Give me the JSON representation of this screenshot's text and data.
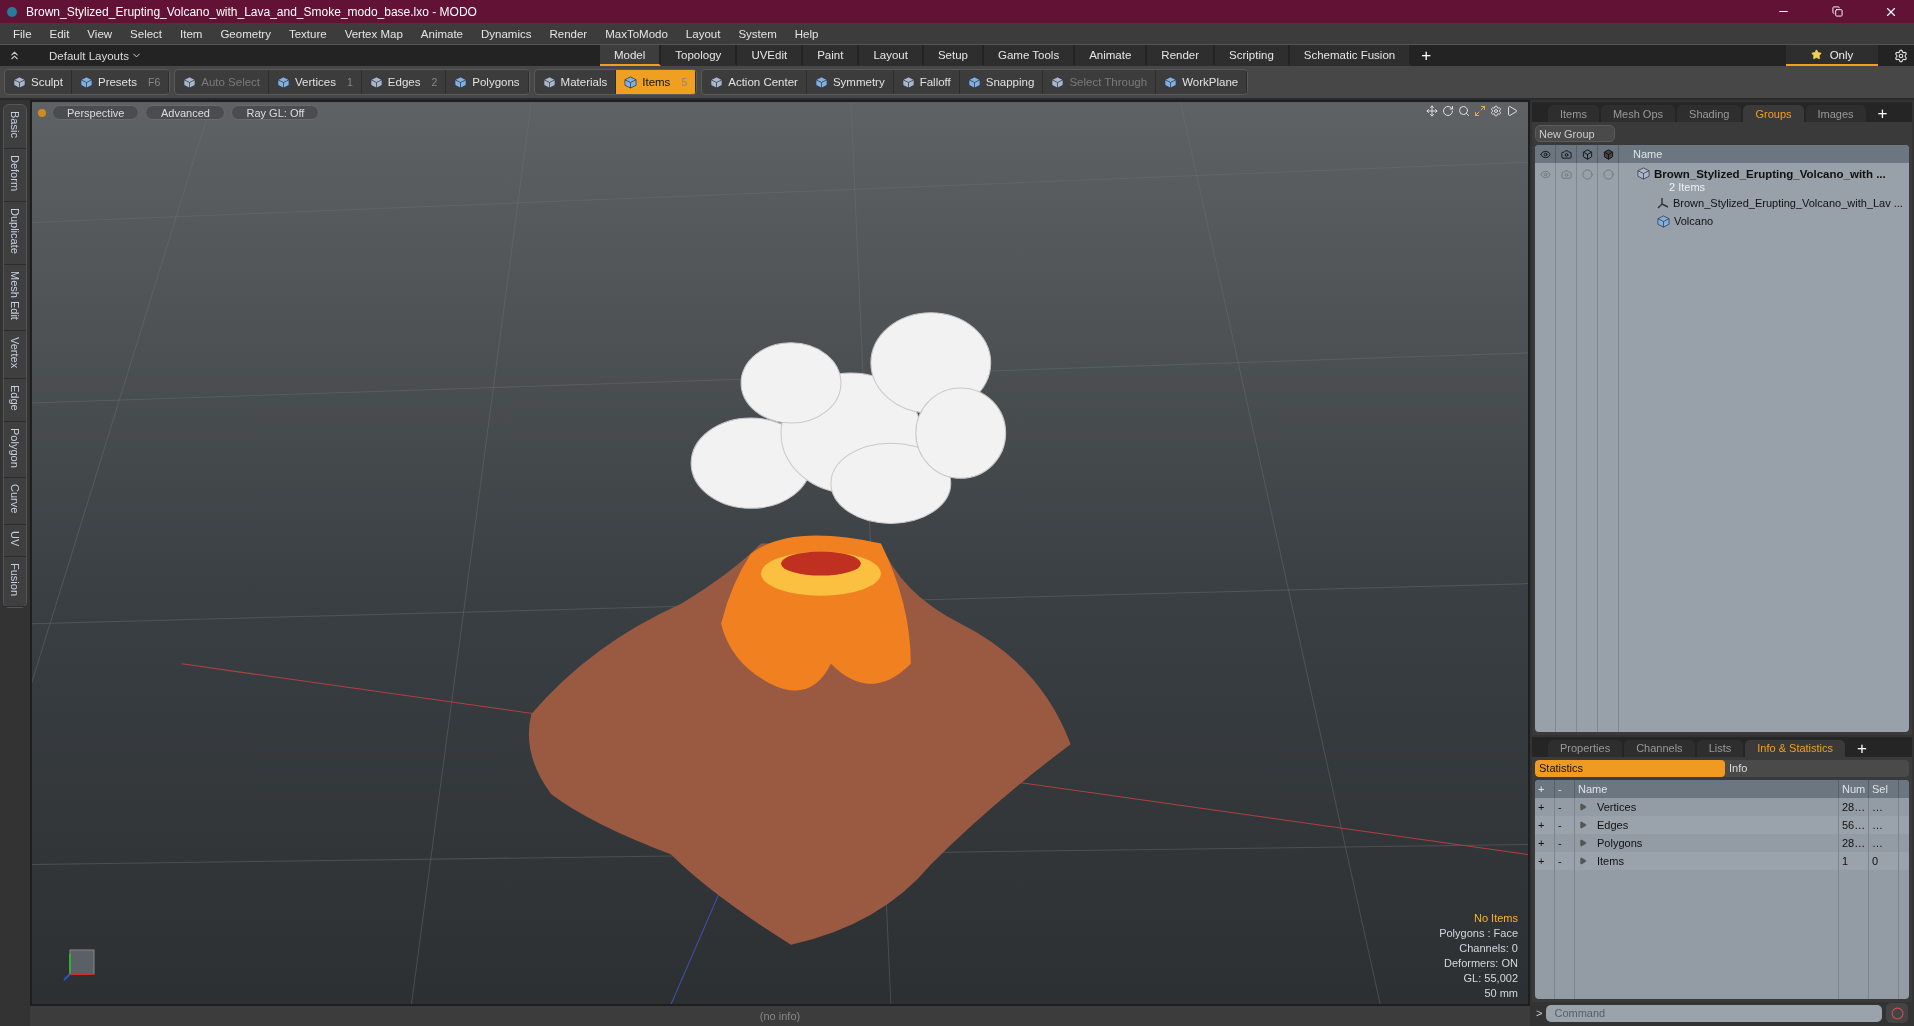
{
  "window": {
    "title": "Brown_Stylized_Erupting_Volcano_with_Lava_and_Smoke_modo_base.lxo - MODO"
  },
  "menu": [
    "File",
    "Edit",
    "View",
    "Select",
    "Item",
    "Geometry",
    "Texture",
    "Vertex Map",
    "Animate",
    "Dynamics",
    "Render",
    "MaxToModo",
    "Layout",
    "System",
    "Help"
  ],
  "layout_bar": {
    "preset": "Default Layouts",
    "tabs": [
      {
        "label": "Model",
        "selected": true
      },
      {
        "label": "Topology",
        "selected": false
      },
      {
        "label": "UVEdit",
        "selected": false
      },
      {
        "label": "Paint",
        "selected": false
      },
      {
        "label": "Layout",
        "selected": false
      },
      {
        "label": "Setup",
        "selected": false
      },
      {
        "label": "Game Tools",
        "selected": false
      },
      {
        "label": "Animate",
        "selected": false
      },
      {
        "label": "Render",
        "selected": false
      },
      {
        "label": "Scripting",
        "selected": false
      },
      {
        "label": "Schematic Fusion",
        "selected": false
      }
    ],
    "add": "+",
    "only": "Only"
  },
  "toolbar": [
    {
      "tools": [
        {
          "label": "Sculpt",
          "selected": false,
          "disabled": false
        },
        {
          "label": "Presets",
          "shortcut": "F6",
          "selected": false,
          "disabled": false
        }
      ]
    },
    {
      "tools": [
        {
          "label": "Auto Select",
          "selected": false,
          "disabled": true
        },
        {
          "label": "Vertices",
          "shortcut": "1",
          "selected": false,
          "disabled": false
        },
        {
          "label": "Edges",
          "shortcut": "2",
          "selected": false,
          "disabled": false
        },
        {
          "label": "Polygons",
          "selected": false,
          "disabled": false
        }
      ]
    },
    {
      "tools": [
        {
          "label": "Materials",
          "selected": false,
          "disabled": false
        },
        {
          "label": "Items",
          "shortcut": "5",
          "selected": true,
          "disabled": false
        }
      ]
    },
    {
      "tools": [
        {
          "label": "Action Center",
          "selected": false,
          "disabled": false
        },
        {
          "label": "Symmetry",
          "selected": false,
          "disabled": false
        },
        {
          "label": "Falloff",
          "selected": false,
          "disabled": false
        },
        {
          "label": "Snapping",
          "selected": false,
          "disabled": false
        },
        {
          "label": "Select Through",
          "selected": false,
          "disabled": true
        },
        {
          "label": "WorkPlane",
          "selected": false,
          "disabled": false
        }
      ]
    }
  ],
  "side_tabs": [
    "Basic",
    "Deform",
    "Duplicate",
    "Mesh Edit",
    "Vertex",
    "Edge",
    "Polygon",
    "Curve",
    "UV",
    "Fusion"
  ],
  "viewport": {
    "buttons": [
      "Perspective",
      "Advanced",
      "Ray GL: Off"
    ],
    "info": [
      {
        "text": "No Items",
        "kind": "status"
      },
      {
        "text": "Polygons : Face",
        "kind": "plain"
      },
      {
        "text": "Channels: 0",
        "kind": "plain"
      },
      {
        "text": "Deformers: ON",
        "kind": "plain"
      },
      {
        "text": "GL: 55,002",
        "kind": "plain"
      },
      {
        "text": "50 mm",
        "kind": "plain"
      }
    ]
  },
  "status_bar": "(no info)",
  "groups_panel": {
    "tabs": [
      {
        "label": "Items",
        "selected": false
      },
      {
        "label": "Mesh Ops",
        "selected": false
      },
      {
        "label": "Shading",
        "selected": false
      },
      {
        "label": "Groups",
        "selected": true
      },
      {
        "label": "Images",
        "selected": false
      }
    ],
    "add": "+",
    "new_group": "New Group",
    "name_column": "Name",
    "group": {
      "name": "Brown_Stylized_Erupting_Volcano_with ...",
      "count": "2 Items",
      "children": [
        {
          "name": "Brown_Stylized_Erupting_Volcano_with_Lav ...",
          "kind": "locator"
        },
        {
          "name": "Volcano",
          "kind": "mesh"
        }
      ]
    }
  },
  "stats_panel": {
    "tabs": [
      {
        "label": "Properties",
        "selected": false
      },
      {
        "label": "Channels",
        "selected": false
      },
      {
        "label": "Lists",
        "selected": false
      },
      {
        "label": "Info & Statistics",
        "selected": true
      }
    ],
    "add": "+",
    "subtabs": [
      {
        "label": "Statistics",
        "selected": true
      },
      {
        "label": "Info",
        "selected": false
      }
    ],
    "columns": [
      "+",
      "-",
      "Name",
      "Num",
      "Sel"
    ],
    "rows": [
      {
        "add": "+",
        "remove": "-",
        "name": "Vertices",
        "num": "28…",
        "sel": "…"
      },
      {
        "add": "+",
        "remove": "-",
        "name": "Edges",
        "num": "56…",
        "sel": "…"
      },
      {
        "add": "+",
        "remove": "-",
        "name": "Polygons",
        "num": "28…",
        "sel": "…"
      },
      {
        "add": "+",
        "remove": "-",
        "name": "Items",
        "num": "1",
        "sel": "0"
      }
    ]
  },
  "command": {
    "prompt": ">",
    "placeholder": "Command"
  }
}
